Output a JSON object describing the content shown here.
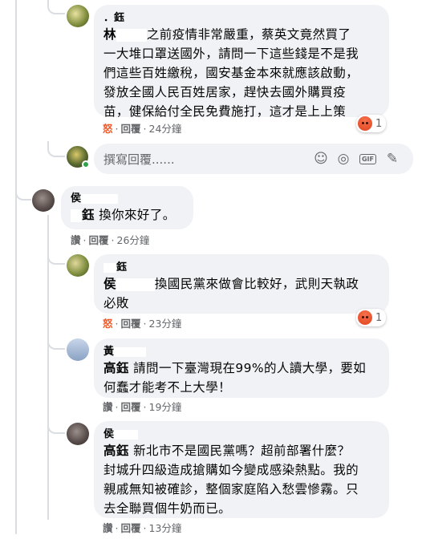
{
  "comments": [
    {
      "author": "．鈺",
      "mention": "林",
      "text": "之前疫情非常嚴重，蔡英文竟然買了一大堆口罩送國外，請問一下這些錢是不是我們這些百姓繳稅，國安基金本來就應該啟動，發放全國人民百姓居家，趕快去國外購買疫苗，健保給付全民免費施打，這才是上上策",
      "line1": "之前疫情非常嚴重，蔡英文竟然買了",
      "line2": "一大堆口罩送國外，請問一下這些錢是不是我",
      "line3": "們這些百姓繳稅，國安基金本來就應該啟動，",
      "line4": "發放全國人民百姓居家，趕快去國外購買疫",
      "line5": "苗，健保給付全民免費施打，這才是上上策",
      "reaction_label": "怒",
      "reply_label": "回覆",
      "time": "24分鐘",
      "reaction_count": "1"
    },
    {
      "author": "侯",
      "mention": "鈺",
      "text": "換你來好了。",
      "reaction_label": "讚",
      "reply_label": "回覆",
      "time": "26分鐘"
    },
    {
      "author": "鈺",
      "mention": "侯",
      "line1": "換國民黨來做會比較好，武則天執政",
      "line2": "必敗",
      "reaction_label": "怒",
      "reply_label": "回覆",
      "time": "23分鐘",
      "reaction_count": "1"
    },
    {
      "author": "黃",
      "mention": "高鈺",
      "line1": "請問一下臺灣現在99%的人讀大學，要如",
      "line2": "何蠢才能考不上大學！",
      "reaction_label": "讚",
      "reply_label": "回覆",
      "time": "19分鐘"
    },
    {
      "author": "侯",
      "mention": "高鈺",
      "line1": "新北市不是國民黨嗎？超前部署什麼？",
      "line2": "封城升四級造成搶購如今變成感染熱點。我的",
      "line3": "親戚無知被確診，整個家庭陷入愁雲慘霧。只",
      "line4": "去全聯買個牛奶而已。",
      "reaction_label": "讚",
      "reply_label": "回覆",
      "time": "13分鐘"
    }
  ],
  "reply_box": {
    "placeholder": "撰寫回覆......",
    "icons": [
      "smiley-icon",
      "camera-icon",
      "gif-icon",
      "sticker-icon"
    ]
  },
  "colors": {
    "bubble": "#f0f2f5",
    "meta_text": "#65676b",
    "angry_reaction": "#f05a2b"
  }
}
